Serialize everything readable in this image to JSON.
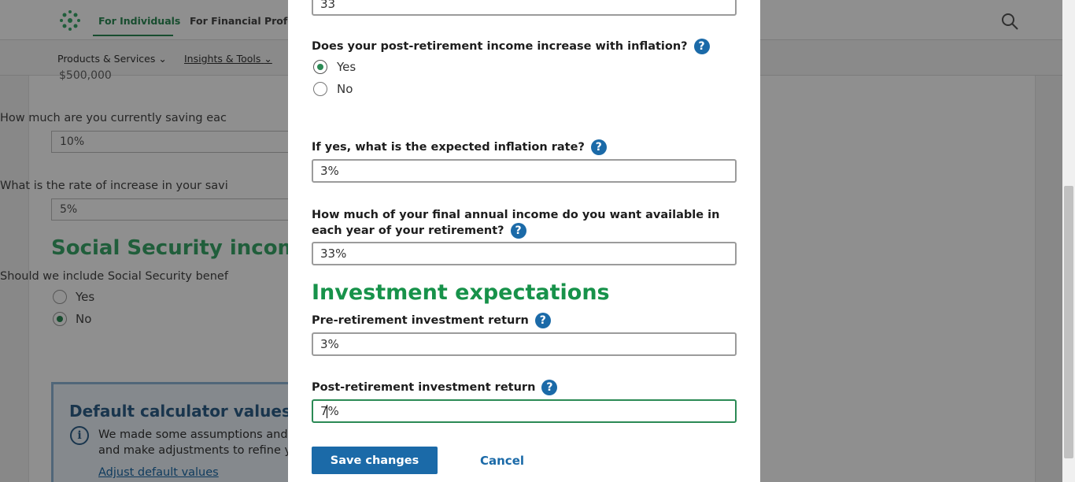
{
  "background": {
    "nav": {
      "for_individuals": "For Individuals",
      "for_financial": "For Financial Profes",
      "products_services": "Products & Services",
      "insights_tools": "Insights & Tools"
    },
    "top_field_value": "$500,000",
    "saving_label": "How much are you currently saving eac",
    "saving_value": "10%",
    "increase_label": "What is the rate of increase in your savi",
    "increase_value": "5%",
    "social_security_heading": "Social Security income",
    "social_security_question": "Should we include Social Security benef",
    "social_security_options": [
      "Yes",
      "No"
    ],
    "social_security_selected": "No",
    "defaults_title": "Default calculator values",
    "defaults_text": "We made some assumptions and and make adjustments to refine y",
    "defaults_link": "Adjust default values"
  },
  "modal": {
    "top_field_value": "33",
    "inflation_question": "Does your post-retirement income increase with inflation?",
    "inflation_options": [
      "Yes",
      "No"
    ],
    "inflation_selected": "Yes",
    "inflation_rate_label": "If yes, what is the expected inflation rate?",
    "inflation_rate_value": "3%",
    "final_income_label": "How much of your final annual income do you want available in each year of your retirement?",
    "final_income_value": "33%",
    "investment_heading": "Investment expectations",
    "pre_return_label": "Pre-retirement investment return",
    "pre_return_value": "3%",
    "post_return_label": "Post-retirement investment return",
    "post_return_value": "7%",
    "help_glyph": "?",
    "save_label": "Save changes",
    "cancel_label": "Cancel"
  },
  "colors": {
    "brand_green": "#17924a",
    "brand_blue": "#1b6aa8"
  }
}
